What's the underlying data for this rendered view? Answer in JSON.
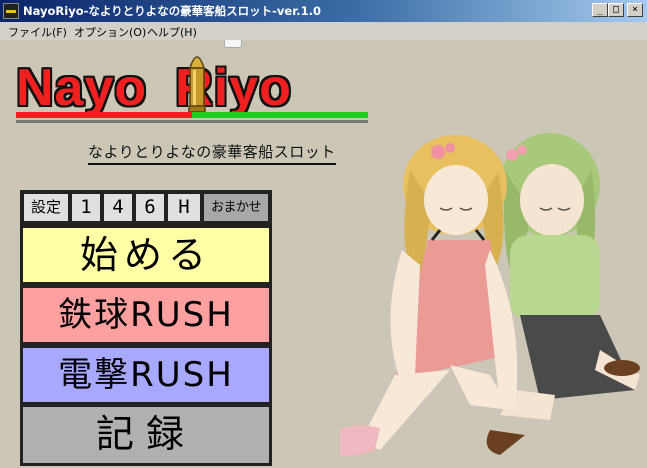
{
  "window": {
    "title": "NayoRiyo-なよりとりよなの豪華客船スロット-ver.1.0",
    "controls": {
      "minimize": "_",
      "maximize": "□",
      "close": "×"
    }
  },
  "menu": {
    "items": [
      "ファイル(F)",
      "オプション(O)",
      "ヘルプ(H)"
    ]
  },
  "logo": {
    "left": "Nayo",
    "right": "Riyo",
    "subtitle": "なよりとりよなの豪華客船スロット"
  },
  "settings": {
    "label": "設定",
    "options": [
      "1",
      "4",
      "6",
      "H"
    ],
    "auto": "おまかせ",
    "selected": "おまかせ"
  },
  "buttons": {
    "start": "始める",
    "tekkyu_rush": "鉄球RUSH",
    "dengeki_rush": "電撃RUSH",
    "records": "記録"
  },
  "colors": {
    "start_bg": "#ffffa6",
    "tekkyu_bg": "#ffa0a0",
    "dengeki_bg": "#a8a8ff",
    "records_bg": "#b0b0b0",
    "logo_red": "#ee2020",
    "logo_green": "#20cc20"
  }
}
